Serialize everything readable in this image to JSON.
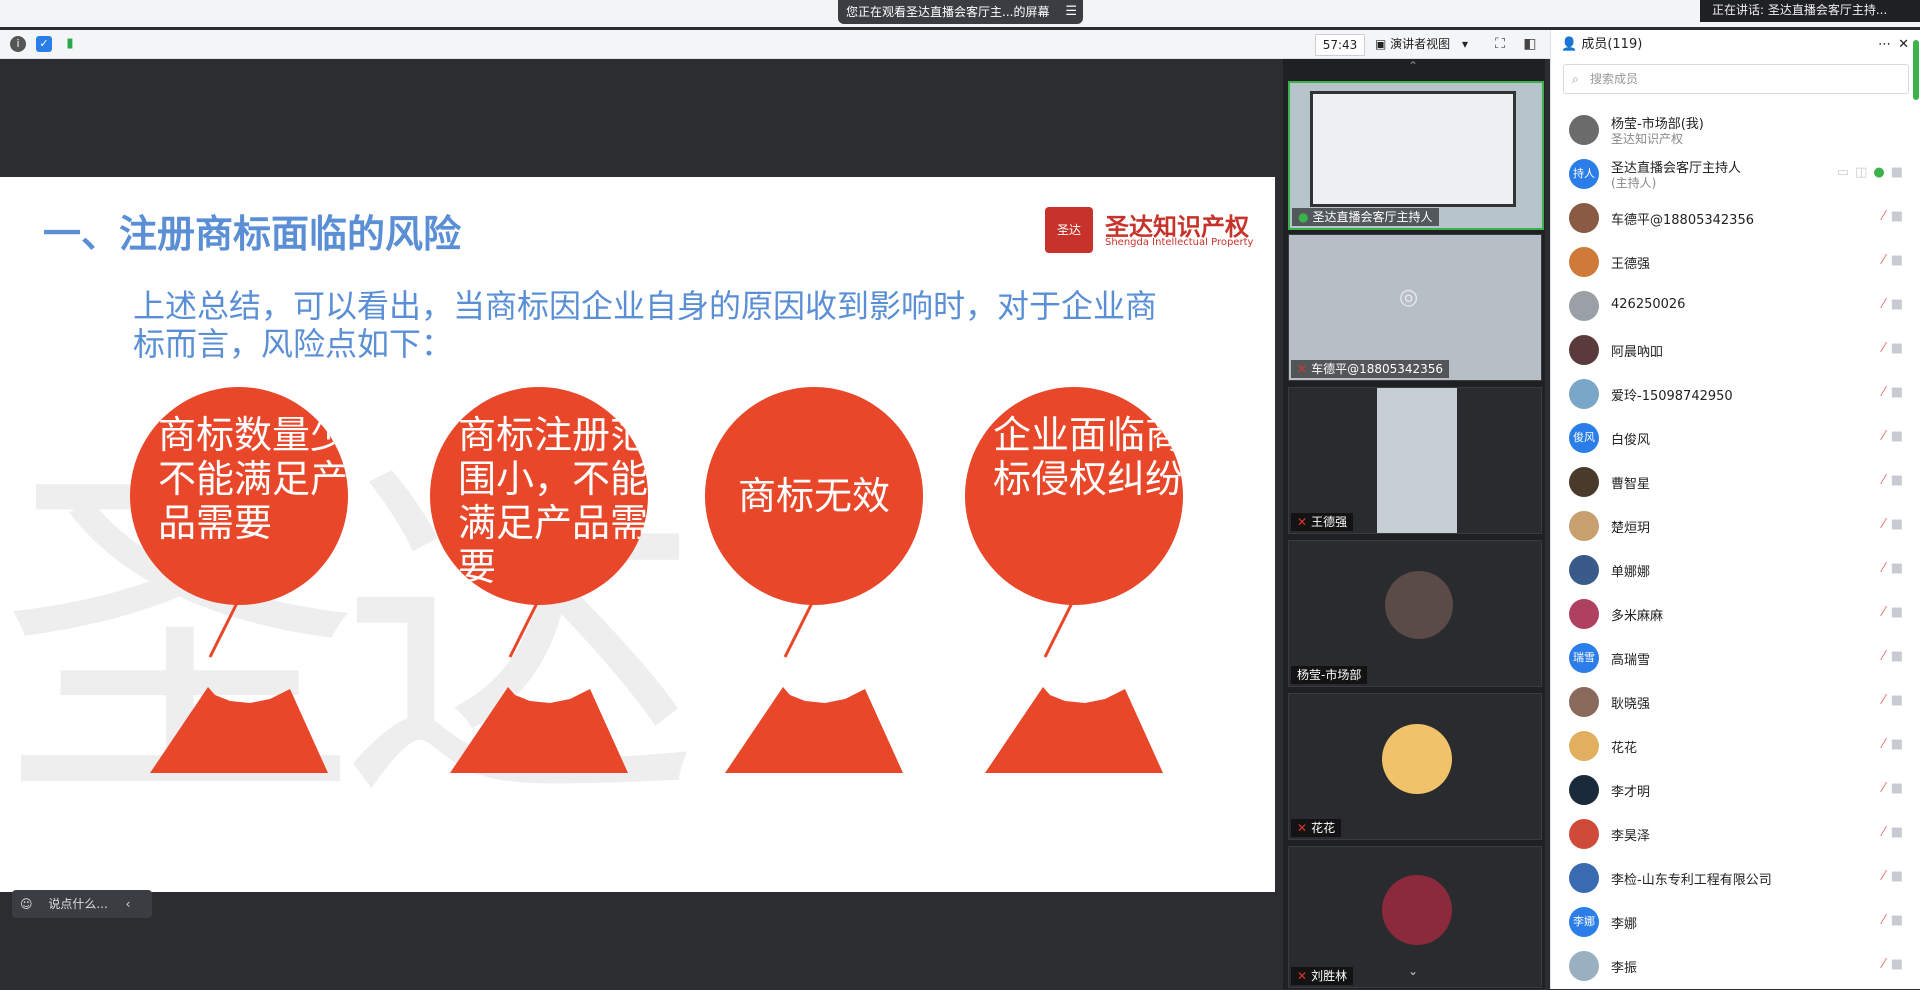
{
  "window": {
    "share_banner": "您正在观看圣达直播会客厅主...的屏幕",
    "speaking": "正在讲话: 圣达直播会客厅主持..."
  },
  "toolbar": {
    "timer": "57:43",
    "view_mode": "演讲者视图"
  },
  "slide": {
    "title": "一、注册商标面临的风险",
    "brand_name": "圣达知识产权",
    "brand_sub": "Shengda Intellectual Property",
    "seal_text": "圣达",
    "watermark": "圣达",
    "body": "上述总结，可以看出，当商标因企业自身的原因收到影响时，对于企业商标而言，风险点如下：",
    "risks": [
      "商标数量少不能满足产品需要",
      "商标注册范围小，不能满足产品需要",
      "商标无效",
      "企业面临商标侵权纠纷"
    ],
    "accent_color": "#e8472a",
    "title_color": "#5a8fd6"
  },
  "chat": {
    "placeholder": "说点什么..."
  },
  "videos": [
    {
      "name": "圣达直播会客厅主持人",
      "muted": false
    },
    {
      "name": "车德平@18805342356",
      "muted": true
    },
    {
      "name": "王德强",
      "muted": true
    },
    {
      "name": "杨莹-市场部",
      "muted": false
    },
    {
      "name": "花花",
      "muted": true
    },
    {
      "name": "刘胜林",
      "muted": true
    }
  ],
  "members": {
    "title": "成员(119)",
    "search_placeholder": "搜索成员",
    "list": [
      {
        "name": "杨莹-市场部(我)",
        "sub": "圣达知识产权",
        "avatar": "",
        "color": "#6b6b6b"
      },
      {
        "name": "圣达直播会客厅主持人",
        "sub": "(主持人)",
        "avatar": "持人",
        "color": "#2b7de9"
      },
      {
        "name": "车德平@18805342356",
        "sub": "",
        "avatar": "",
        "color": "#8a5a44"
      },
      {
        "name": "王德强",
        "sub": "",
        "avatar": "",
        "color": "#d07a3a"
      },
      {
        "name": "426250026",
        "sub": "",
        "avatar": "",
        "color": "#9aa0a6"
      },
      {
        "name": "阿晨吶吅",
        "sub": "",
        "avatar": "",
        "color": "#5a3a3a"
      },
      {
        "name": "爱玲-15098742950",
        "sub": "",
        "avatar": "",
        "color": "#7aa6c8"
      },
      {
        "name": "白俊风",
        "sub": "",
        "avatar": "俊风",
        "color": "#2b7de9"
      },
      {
        "name": "曹智星",
        "sub": "",
        "avatar": "",
        "color": "#4a3a2a"
      },
      {
        "name": "楚烜玥",
        "sub": "",
        "avatar": "",
        "color": "#c8a070"
      },
      {
        "name": "单娜娜",
        "sub": "",
        "avatar": "",
        "color": "#3a5a8a"
      },
      {
        "name": "多米麻麻",
        "sub": "",
        "avatar": "",
        "color": "#b04060"
      },
      {
        "name": "高瑞雪",
        "sub": "",
        "avatar": "瑞雪",
        "color": "#2b7de9"
      },
      {
        "name": "耿晓强",
        "sub": "",
        "avatar": "",
        "color": "#8a6a5a"
      },
      {
        "name": "花花",
        "sub": "",
        "avatar": "",
        "color": "#e0b060"
      },
      {
        "name": "李才明",
        "sub": "",
        "avatar": "",
        "color": "#1a2a3a"
      },
      {
        "name": "李昊泽",
        "sub": "",
        "avatar": "",
        "color": "#d04a3a"
      },
      {
        "name": "李检-山东专利工程有限公司",
        "sub": "",
        "avatar": "",
        "color": "#3a6ab0"
      },
      {
        "name": "李娜",
        "sub": "",
        "avatar": "李娜",
        "color": "#2b7de9"
      },
      {
        "name": "李振",
        "sub": "",
        "avatar": "",
        "color": "#9ab0c0"
      }
    ]
  }
}
